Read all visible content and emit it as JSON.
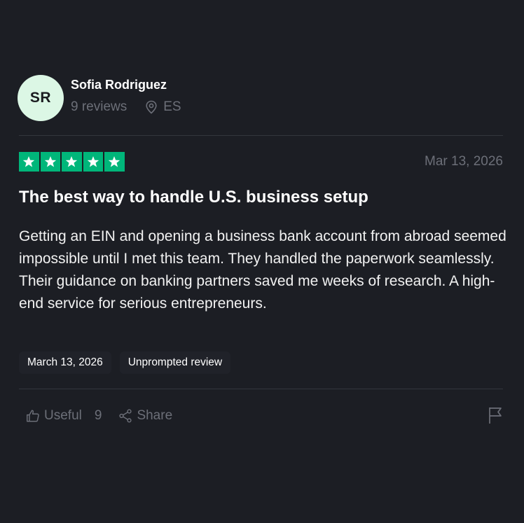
{
  "review": {
    "author": {
      "initials": "SR",
      "name": "Sofia Rodriguez",
      "reviews_count": "9 reviews",
      "country": "ES"
    },
    "rating": 5,
    "rating_color": "#00b67a",
    "date_short": "Mar 13, 2026",
    "title": "The best way to handle U.S. business setup",
    "body": "Getting an EIN and opening a business bank account from abroad seemed impossible until I met this team. They handled the paperwork seamlessly. Their guidance on banking partners saved me weeks of research. A high-end service for serious entrepreneurs.",
    "chips": {
      "date_long": "March 13, 2026",
      "review_type": "Unprompted review"
    },
    "actions": {
      "useful_label": "Useful",
      "useful_count": "9",
      "share_label": "Share"
    }
  },
  "icons": {
    "location": "map-pin-icon",
    "useful": "thumbs-up-icon",
    "share": "share-icon",
    "report": "flag-icon",
    "star": "star-icon"
  },
  "colors": {
    "background": "#1c1e24",
    "avatar_bg": "#dcf7e5",
    "muted_text": "#6c6f78",
    "chip_bg": "#202229"
  }
}
